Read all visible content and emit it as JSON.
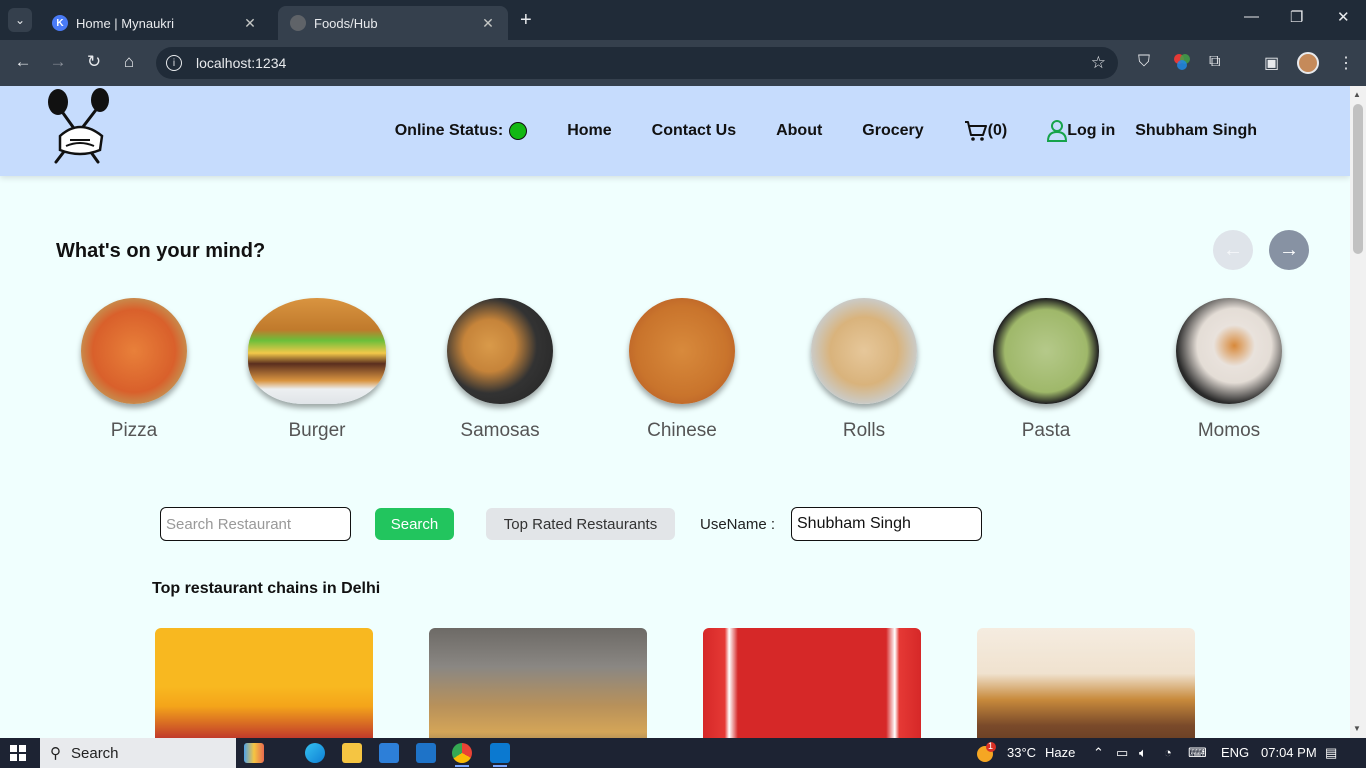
{
  "browser": {
    "tabs": [
      {
        "title": "Home | Mynaukri",
        "active": false,
        "favicon": "mynaukri-k-icon"
      },
      {
        "title": "Foods/Hub",
        "active": true,
        "favicon": "globe-icon"
      }
    ],
    "url": "localhost:1234"
  },
  "header": {
    "online_status_label": "Online Status:",
    "online_color": "#12b812",
    "nav": [
      "Home",
      "Contact Us",
      "About",
      "Grocery"
    ],
    "cart_count": "(0)",
    "login_label": "Log in",
    "user_name": "Shubham Singh"
  },
  "mind": {
    "title": "What's on your mind?",
    "items": [
      {
        "label": "Pizza"
      },
      {
        "label": "Burger"
      },
      {
        "label": "Samosas"
      },
      {
        "label": "Chinese"
      },
      {
        "label": "Rolls"
      },
      {
        "label": "Pasta"
      },
      {
        "label": "Momos"
      }
    ]
  },
  "search": {
    "placeholder": "Search Restaurant",
    "button": "Search",
    "top_rated": "Top Rated Restaurants",
    "username_label": "UseName :",
    "username_value": "Shubham Singh"
  },
  "chains": {
    "title": "Top restaurant chains in Delhi"
  },
  "taskbar": {
    "search_label": "Search",
    "weather": "33°C",
    "weather_desc": "Haze",
    "weather_badge": "1",
    "lang": "ENG",
    "time": "07:04 PM"
  }
}
